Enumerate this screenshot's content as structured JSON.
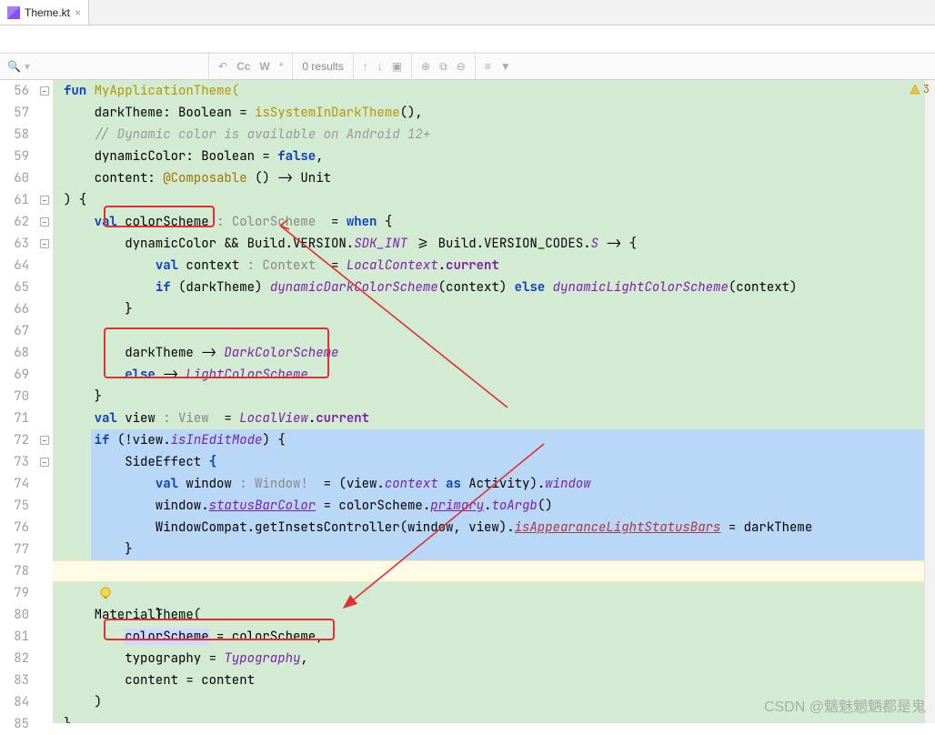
{
  "tab": {
    "fileName": "Theme.kt",
    "iconName": "kotlin-file-icon"
  },
  "findBar": {
    "placeholder": "",
    "results": "0 results",
    "cc": "Cc",
    "word": "W",
    "regex": "*"
  },
  "gutter": {
    "lines": [
      "56",
      "57",
      "58",
      "59",
      "60",
      "61",
      "62",
      "63",
      "64",
      "65",
      "66",
      "67",
      "68",
      "69",
      "70",
      "71",
      "72",
      "73",
      "74",
      "75",
      "76",
      "77",
      "78",
      "79",
      "80",
      "81",
      "82",
      "83",
      "84",
      "85"
    ]
  },
  "warning": {
    "count": "3"
  },
  "watermark": "CSDN @魑魅魍魉都是鬼",
  "code": {
    "l56": {
      "kw": "fun",
      "name": " MyApplicationTheme("
    },
    "l57": {
      "p": "    darkTheme: Boolean = ",
      "fn": "isSystemInDarkTheme",
      "tail": "(),"
    },
    "l58": {
      "com": "    // Dynamic color is available on Android 12+"
    },
    "l59": {
      "p": "    dynamicColor: Boolean = ",
      "kw": "false",
      "tail": ","
    },
    "l60": {
      "p": "    content: ",
      "ann": "@Composable",
      "tail": " () -> Unit"
    },
    "l61": {
      "p": ") {"
    },
    "l62": {
      "p": "    ",
      "kw": "val",
      "name": " colorScheme ",
      "type": ": ColorScheme ",
      "eq": " = ",
      "kw2": "when",
      "tail": " {"
    },
    "l63": {
      "p": "        dynamicColor && Build.VERSION.",
      "it": "SDK_INT",
      "mid": " >= Build.VERSION_CODES.",
      "it2": "S",
      "tail": " -> {"
    },
    "l64": {
      "p": "            ",
      "kw": "val",
      "name": " context ",
      "type": ": Context ",
      "eq": " = ",
      "it": "LocalContext",
      "tail": ".",
      "prop": "current"
    },
    "l65": {
      "p": "            ",
      "kw": "if",
      "mid": " (darkTheme) ",
      "it": "dynamicDarkColorScheme",
      "args": "(context) ",
      "kw2": "else",
      "sp": " ",
      "it2": "dynamicLightColorScheme",
      "tail": "(context)"
    },
    "l66": {
      "p": "        }"
    },
    "l68": {
      "p": "        darkTheme -> ",
      "it": "DarkColorScheme"
    },
    "l69": {
      "p": "        ",
      "kw": "else",
      "mid": " -> ",
      "it": "LightColorScheme"
    },
    "l70": {
      "p": "    }"
    },
    "l71": {
      "p": "    ",
      "kw": "val",
      "name": " view ",
      "type": ": View ",
      "eq": " = ",
      "it": "LocalView",
      "dot": ".",
      "prop": "current"
    },
    "l72": {
      "p": "    ",
      "kw": "if",
      "mid": " (!view.",
      "it": "isInEditMode",
      "tail": ") {"
    },
    "l73": {
      "p": "        SideEffect ",
      "b": "{"
    },
    "l74": {
      "p": "            ",
      "kw": "val",
      "name": " window ",
      "type": ": Window! ",
      "eq": " = (view.",
      "it": "context",
      "sp": " ",
      "kw2": "as",
      "mid": " Activity).",
      "it2": "window"
    },
    "l75": {
      "p": "            window.",
      "u": "statusBarColor",
      "mid": " = colorScheme.",
      "u2": "primary",
      "dot": ".",
      "it": "toArgb",
      "tail": "()"
    },
    "l76": {
      "p": "            WindowCompat.getInsetsController(window, view).",
      "u": "isAppearanceLightStatusBars",
      "tail": " = darkTheme"
    },
    "l77": {
      "p": "        }"
    },
    "l78": {
      "p": "    }"
    },
    "l80": {
      "p": "    MaterialTheme("
    },
    "l81": {
      "p": "        ",
      "sel": "colorScheme",
      "mid": " = colorScheme,"
    },
    "l82": {
      "p": "        typography = ",
      "it": "Typography",
      "tail": ","
    },
    "l83": {
      "p": "        content = content"
    },
    "l84": {
      "p": "    )"
    },
    "l85": {
      "p": "}"
    }
  }
}
